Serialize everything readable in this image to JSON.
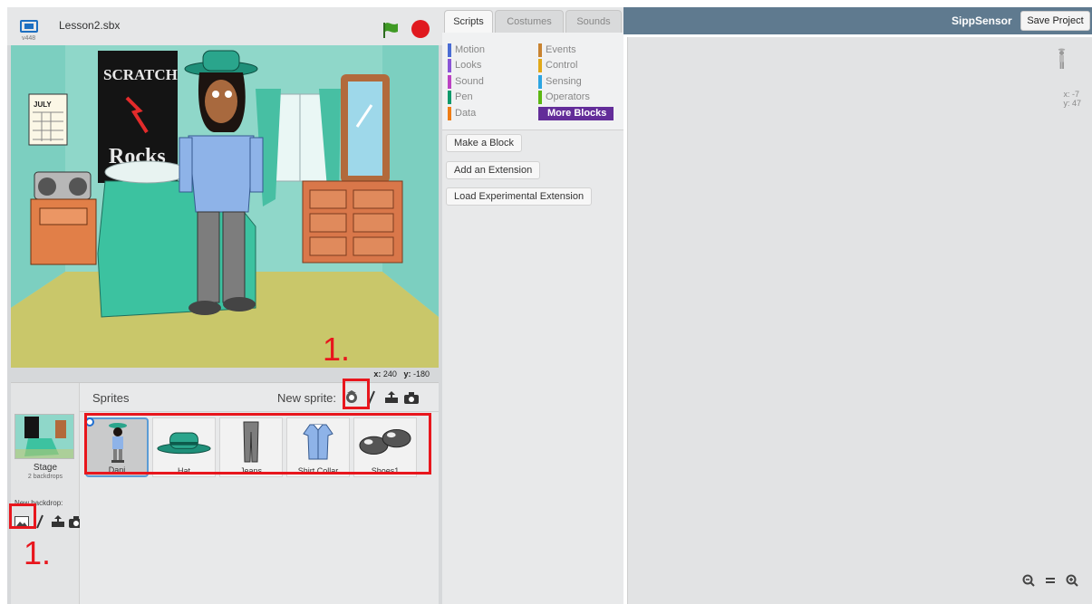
{
  "project": {
    "title": "Lesson2.sbx",
    "version": "v448"
  },
  "stage": {
    "coords_x_label": "x:",
    "coords_x": "240",
    "coords_y_label": "y:",
    "coords_y": "-180",
    "poster_line1": "SCRATCH",
    "poster_line2": "Rocks",
    "calendar_label": "JULY"
  },
  "sprites_panel": {
    "title": "Sprites",
    "new_sprite_label": "New sprite:",
    "stage_label": "Stage",
    "stage_sub": "2 backdrops",
    "new_backdrop_label": "New backdrop:",
    "sprites": [
      {
        "name": "Dani",
        "icon": "person-icon"
      },
      {
        "name": "Hat",
        "icon": "hat-icon"
      },
      {
        "name": "Jeans",
        "icon": "jeans-icon"
      },
      {
        "name": "Shirt Collar",
        "icon": "shirt-icon"
      },
      {
        "name": "Shoes1",
        "icon": "shoes-icon"
      }
    ]
  },
  "annotations": {
    "step_top": "1.",
    "step_bottom": "1.",
    "color": "#e8161d"
  },
  "palette": {
    "tabs": [
      "Scripts",
      "Costumes",
      "Sounds"
    ],
    "categories_left": [
      {
        "label": "Motion",
        "color": "#4a6cd4"
      },
      {
        "label": "Looks",
        "color": "#8a55d7"
      },
      {
        "label": "Sound",
        "color": "#bb42c3"
      },
      {
        "label": "Pen",
        "color": "#0e9a6c"
      },
      {
        "label": "Data",
        "color": "#ee7d16"
      }
    ],
    "categories_right": [
      {
        "label": "Events",
        "color": "#c88330"
      },
      {
        "label": "Control",
        "color": "#e1a91a"
      },
      {
        "label": "Sensing",
        "color": "#2ca5e2"
      },
      {
        "label": "Operators",
        "color": "#5cb712"
      },
      {
        "label": "More Blocks",
        "color": "#632d99"
      }
    ],
    "buttons": [
      "Make a Block",
      "Add an Extension",
      "Load Experimental Extension"
    ]
  },
  "topbar": {
    "username": "SippSensor",
    "save_label": "Save Project"
  },
  "scripts_area": {
    "x_label": "x: -7",
    "y_label": "y: 47"
  }
}
